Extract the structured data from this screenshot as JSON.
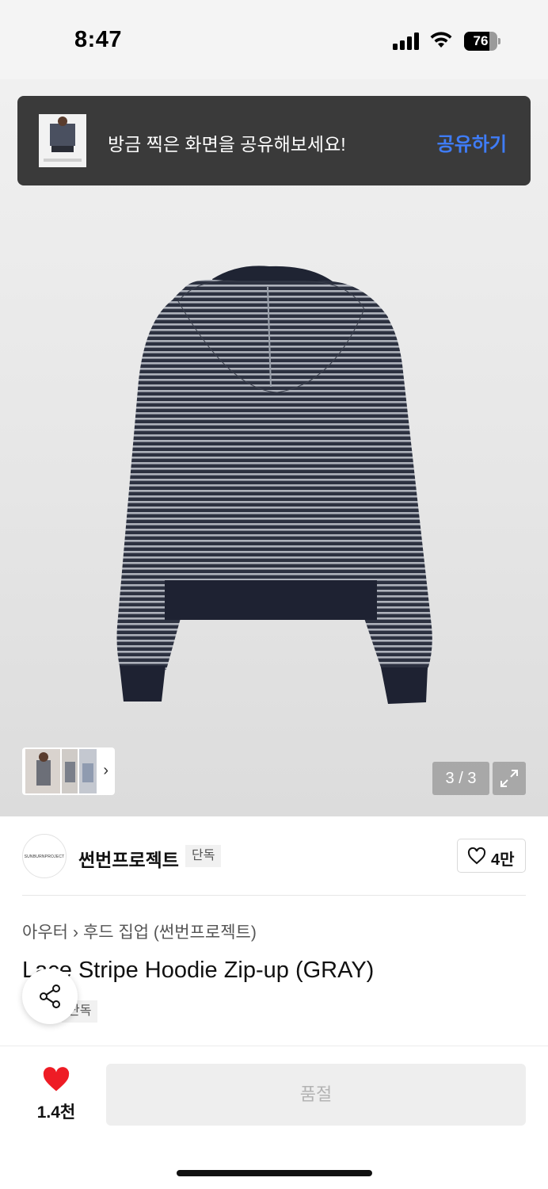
{
  "status_bar": {
    "time": "8:47",
    "battery": "76"
  },
  "toast": {
    "message": "방금 찍은 화면을 공유해보세요!",
    "action_label": "공유하기"
  },
  "gallery": {
    "counter": "3 / 3",
    "current": 3,
    "total": 3
  },
  "brand": {
    "name": "썬번프로젝트",
    "logo_text": "SUNBURNPROJECT",
    "badge": "단독",
    "likes": "4만"
  },
  "product": {
    "breadcrumb": [
      "아우터",
      "후드 집업 (썬번프로젝트)"
    ],
    "title": "Lace Stripe Hoodie Zip-up (GRAY)",
    "badge": "단독"
  },
  "bottom_bar": {
    "wish_count": "1.4천",
    "buy_button_label": "품절"
  },
  "colors": {
    "accent_blue": "#3f7cf7",
    "heart_red": "#ee1c25",
    "toast_bg": "#3a3a3a"
  }
}
